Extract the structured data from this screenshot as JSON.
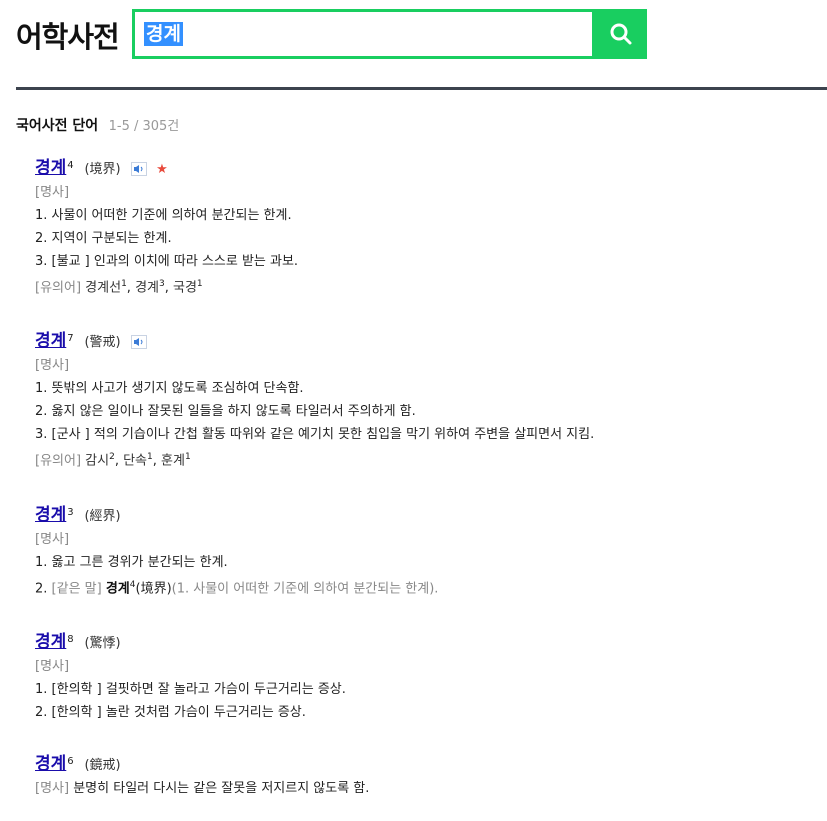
{
  "app": {
    "title": "어학사전"
  },
  "search": {
    "value": "경계"
  },
  "section": {
    "title": "국어사전 단어",
    "count": "1-5 / 305건"
  },
  "entries": [
    {
      "headword": "경계",
      "homonym": "4",
      "hanja": "(境界)",
      "pos": "[명사]",
      "senses": [
        "1. 사물이 어떠한 기준에 의하여 분간되는 한계.",
        "2. 지역이 구분되는 한계.",
        "3. [불교 ] 인과의 이치에 따라 스스로 받는 과보."
      ],
      "syn_label": "[유의어]",
      "syn": [
        {
          "w": "경계선",
          "n": "1"
        },
        {
          "w": "경계",
          "n": "3"
        },
        {
          "w": "국경",
          "n": "1"
        }
      ]
    },
    {
      "headword": "경계",
      "homonym": "7",
      "hanja": "(警戒)",
      "pos": "[명사]",
      "senses": [
        "1. 뜻밖의 사고가 생기지 않도록 조심하여 단속함.",
        "2. 옳지 않은 일이나 잘못된 일들을 하지 않도록 타일러서 주의하게 함.",
        "3. [군사 ] 적의 기습이나 간첩 활동 따위와 같은 예기치 못한 침입을 막기 위하여 주변을 살피면서 지킴."
      ],
      "syn_label": "[유의어]",
      "syn": [
        {
          "w": "감시",
          "n": "2"
        },
        {
          "w": "단속",
          "n": "1"
        },
        {
          "w": "훈계",
          "n": "1"
        }
      ]
    },
    {
      "headword": "경계",
      "homonym": "3",
      "hanja": "(經界)",
      "pos": "[명사]",
      "senses": [
        "1. 옳고 그른 경위가 분간되는 한계."
      ],
      "same_prefix": "2. ",
      "same_label": "[같은 말]",
      "same_word": "경계",
      "same_homonym": "4",
      "same_hanja": "(境界)",
      "same_def": "(1. 사물이 어떠한 기준에 의하여 분간되는 한계)."
    },
    {
      "headword": "경계",
      "homonym": "8",
      "hanja": "(驚悸)",
      "pos": "[명사]",
      "senses": [
        "1. [한의학 ] 걸핏하면 잘 놀라고 가슴이 두근거리는 증상.",
        "2. [한의학 ] 놀란 것처럼 가슴이 두근거리는 증상."
      ]
    },
    {
      "headword": "경계",
      "homonym": "6",
      "hanja": "(鏡戒)",
      "pos": "[명사]",
      "def": "분명히 타일러 다시는 같은 잘못을 저지르지 않도록 함."
    }
  ]
}
